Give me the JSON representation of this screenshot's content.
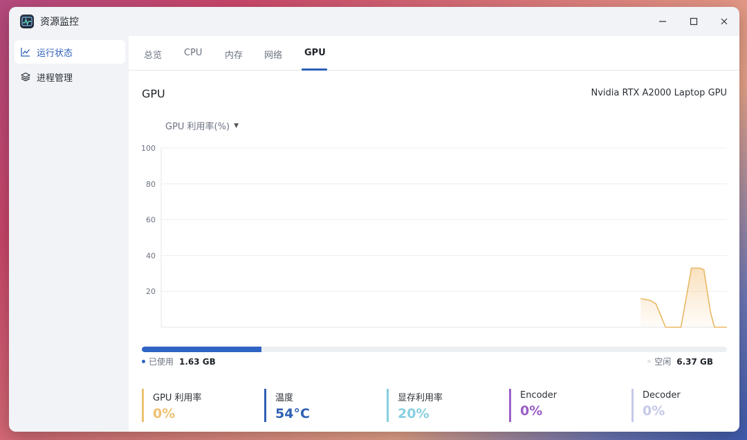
{
  "window": {
    "title": "资源监控",
    "controls": {
      "minimize": "—",
      "maximize": "☐",
      "close": "✕"
    }
  },
  "sidebar": {
    "items": [
      {
        "label": "运行状态",
        "icon": "chart-line-icon",
        "active": true
      },
      {
        "label": "进程管理",
        "icon": "layers-icon",
        "active": false
      }
    ]
  },
  "tabs": {
    "items": [
      {
        "label": "总览",
        "active": false
      },
      {
        "label": "CPU",
        "active": false
      },
      {
        "label": "内存",
        "active": false
      },
      {
        "label": "网络",
        "active": false
      },
      {
        "label": "GPU",
        "active": true
      }
    ]
  },
  "gpu": {
    "title": "GPU",
    "model": "Nvidia RTX A2000 Laptop GPU",
    "metric_select": "GPU 利用率(%)"
  },
  "chart_data": {
    "type": "area",
    "y_ticks": [
      "100",
      "80",
      "60",
      "40",
      "20"
    ],
    "ylim": [
      0,
      100
    ],
    "grid": true,
    "x_count": 60,
    "series": [
      {
        "color": "#e8b863",
        "points": [
          [
            50,
            16
          ],
          [
            51,
            15
          ],
          [
            51.6,
            13
          ],
          [
            52.6,
            0
          ],
          [
            53.6,
            0
          ],
          [
            54.2,
            0
          ],
          [
            54.9,
            21
          ],
          [
            55.3,
            33
          ],
          [
            56.2,
            33
          ],
          [
            56.6,
            32
          ],
          [
            57.3,
            8
          ],
          [
            57.7,
            0
          ],
          [
            59,
            0
          ]
        ]
      }
    ]
  },
  "memory": {
    "used_label": "已使用",
    "used_value": "1.63 GB",
    "free_label": "空闲",
    "free_value": "6.37 GB",
    "used_fraction": 0.204,
    "used_color": "#2f63c4",
    "free_color": "#e5e7eb"
  },
  "stats": [
    {
      "label": "GPU 利用率",
      "value": "0%",
      "color": "#ecc170"
    },
    {
      "label": "温度",
      "value": "54°C",
      "color": "#2f5fb3"
    },
    {
      "label": "显存利用率",
      "value": "20%",
      "color": "#86cfe0"
    },
    {
      "label": "Encoder",
      "value": "0%",
      "color": "#9c5fc7"
    },
    {
      "label": "Decoder",
      "value": "0%",
      "color": "#c6c8e8"
    }
  ]
}
